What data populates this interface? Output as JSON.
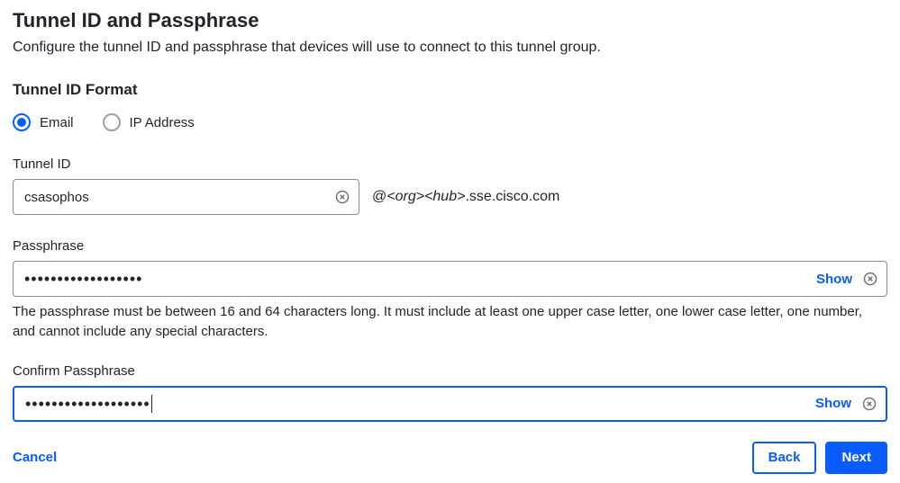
{
  "header": {
    "title": "Tunnel ID and Passphrase",
    "description": "Configure the tunnel ID and passphrase that devices will use to connect to this tunnel group."
  },
  "tunnel_id_format": {
    "heading": "Tunnel ID Format",
    "options": {
      "email": "Email",
      "ip": "IP Address"
    },
    "selected": "email"
  },
  "tunnel_id": {
    "label": "Tunnel ID",
    "value": "csasophos",
    "domain_prefix": "@",
    "domain_org": "<org>",
    "domain_hub": "<hub>",
    "domain_suffix": ".sse.cisco.com"
  },
  "passphrase": {
    "label": "Passphrase",
    "masked_value": "••••••••••••••••••",
    "show_label": "Show",
    "hint": "The passphrase must be between 16 and 64 characters long. It must include at least one upper case letter, one lower case letter, one number, and cannot include any special characters."
  },
  "confirm_passphrase": {
    "label": "Confirm Passphrase",
    "masked_value": "•••••••••••••••••••",
    "show_label": "Show"
  },
  "buttons": {
    "cancel": "Cancel",
    "back": "Back",
    "next": "Next"
  }
}
